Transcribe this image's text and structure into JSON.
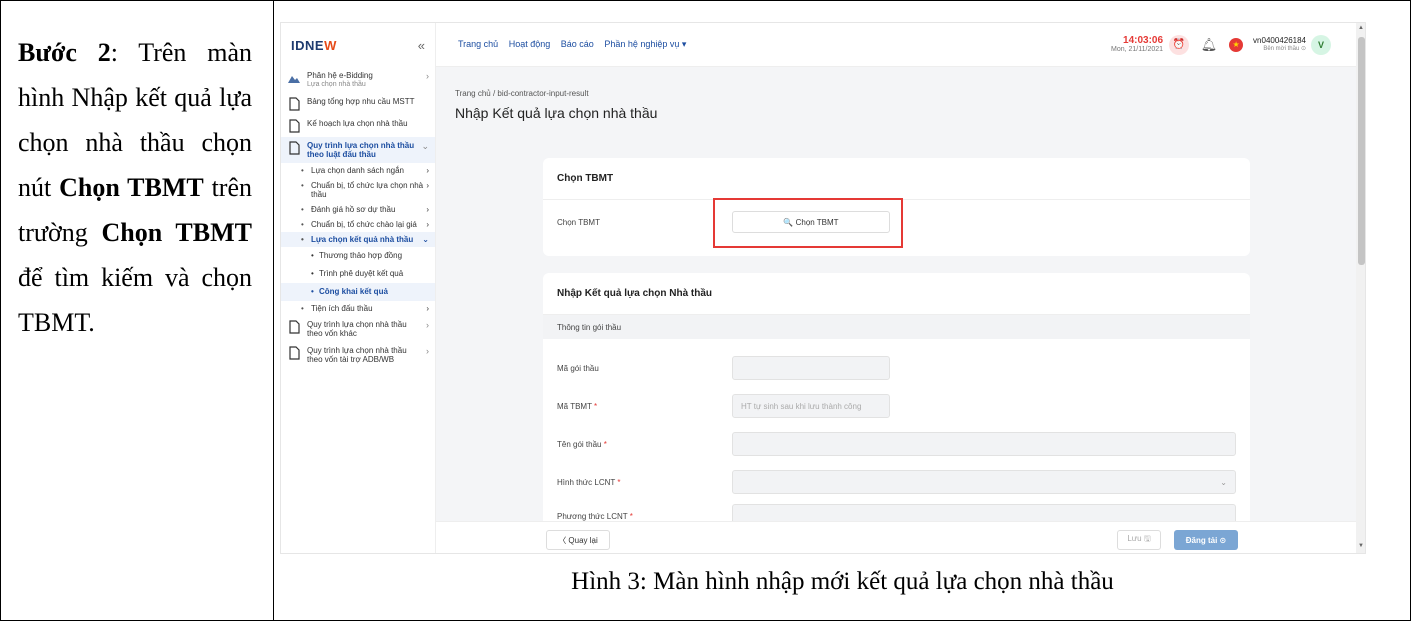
{
  "doc": {
    "step_label": "Bước 2",
    "step_text_1": ": Trên màn hình Nhập kết quả lựa chọn nhà thầu chọn nút ",
    "step_bold_1": "Chọn TBMT",
    "step_text_2": " trên trường ",
    "step_bold_2": "Chọn TBMT",
    "step_text_3": " để tìm kiếm và chọn TBMT.",
    "caption": "Hình 3: Màn hình nhập mới kết quả lựa chọn nhà thầu"
  },
  "app": {
    "logo_a": "IDNE",
    "logo_b": "W",
    "topnav": [
      "Trang chủ",
      "Hoạt động",
      "Báo cáo",
      "Phần hệ nghiệp vụ ▾"
    ],
    "clock_time": "14:03:06",
    "clock_date": "Mon, 21/11/2021",
    "user_name": "vn0400426184",
    "user_role": "Bên mời thầu ⊙",
    "avatar_letter": "V"
  },
  "sidebar": {
    "module_title": "Phân hệ e-Bidding",
    "module_sub": "Lựa chọn nhà thầu",
    "items": [
      "Bảng tổng hợp nhu cầu MSTT",
      "Kế hoạch lựa chọn nhà thầu",
      "Quy trình lựa chọn nhà thầu theo luật đấu thầu"
    ],
    "subitems": [
      "Lựa chọn danh sách ngắn",
      "Chuẩn bị, tổ chức lựa chọn nhà thầu",
      "Đánh giá hồ sơ dự thầu",
      "Chuẩn bị, tổ chức chào lại giá",
      "Lựa chọn kết quả nhà thầu"
    ],
    "subsub": [
      "Thương thảo hợp đồng",
      "Trình phê duyệt kết quả",
      "Công khai kết quả"
    ],
    "tail": [
      "Tiện ích đấu thầu",
      "Quy trình lựa chọn nhà thầu theo vốn khác",
      "Quy trình lựa chọn nhà thầu theo vốn tài trợ ADB/WB"
    ]
  },
  "main": {
    "breadcrumb": "Trang chủ  /  bid-contractor-input-result",
    "title": "Nhập Kết quả lựa chọn nhà thầu",
    "card1_title": "Chọn TBMT",
    "card1_field": "Chọn TBMT",
    "card1_button": "🔍  Chọn TBMT",
    "card2_title": "Nhập Kết quả lựa chọn Nhà thầu",
    "section": "Thông tin gói thầu",
    "f_ma_goi": "Mã gói thầu",
    "f_ma_tbmt": "Mã TBMT ",
    "f_ma_tbmt_ph": "HT tự sinh sau khi lưu thành công",
    "f_ten_goi": "Tên gói thầu ",
    "f_hinh_thuc": "Hình thức LCNT ",
    "f_phuong_thuc": "Phương thức LCNT ",
    "req": "*",
    "btn_back": "〈  Quay lại",
    "btn_save": "Lưu 🖫",
    "btn_post": "Đăng tải ⊙"
  }
}
